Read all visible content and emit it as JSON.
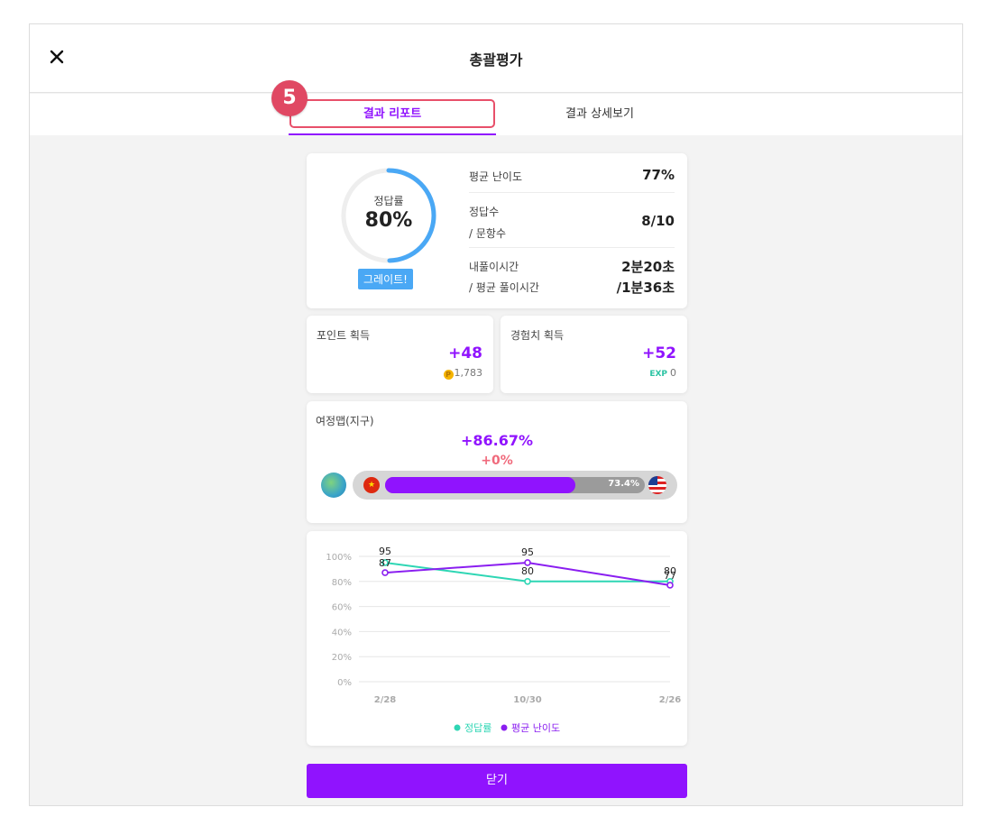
{
  "header": {
    "title": "총괄평가"
  },
  "tabs": [
    {
      "label": "결과 리포트",
      "active": true
    },
    {
      "label": "결과 상세보기",
      "active": false
    }
  ],
  "callout": {
    "number": "5"
  },
  "summary": {
    "rate_label": "정답률",
    "rate_value": "80%",
    "rate_fraction": 0.8,
    "badge": "그레이트!",
    "avg_difficulty_label": "평균 난이도",
    "avg_difficulty_value": "77%",
    "correct_label": "정답수",
    "questions_label": "/ 문항수",
    "correct_value": "8/10",
    "my_time_label": "내풀이시간",
    "avg_time_label": "/ 평균 풀이시간",
    "my_time_value": "2분20초",
    "avg_time_value": "/1분36초"
  },
  "points": {
    "label": "포인트 획득",
    "value": "+48",
    "coin_icon": "P",
    "total": "1,783"
  },
  "exp": {
    "label": "경험치 획득",
    "value": "+52",
    "icon_text": "EXP",
    "total": "0"
  },
  "journey": {
    "label": "여정맵(지구)",
    "main": "+86.67%",
    "sub": "+0%",
    "progress_label": "73.4%",
    "progress": 0.734
  },
  "chart_data": {
    "type": "line",
    "categories": [
      "2/28",
      "10/30",
      "2/26"
    ],
    "ylim": [
      0,
      100
    ],
    "yticks": [
      "100%",
      "80%",
      "60%",
      "40%",
      "20%",
      "0%"
    ],
    "series": [
      {
        "name": "정답률",
        "color": "#2ed6b4",
        "values": [
          95,
          80,
          80
        ]
      },
      {
        "name": "평균 난이도",
        "color": "#8a1ef0",
        "values": [
          87,
          95,
          77
        ]
      }
    ],
    "legend_position": "bottom"
  },
  "footer": {
    "close_label": "닫기"
  }
}
